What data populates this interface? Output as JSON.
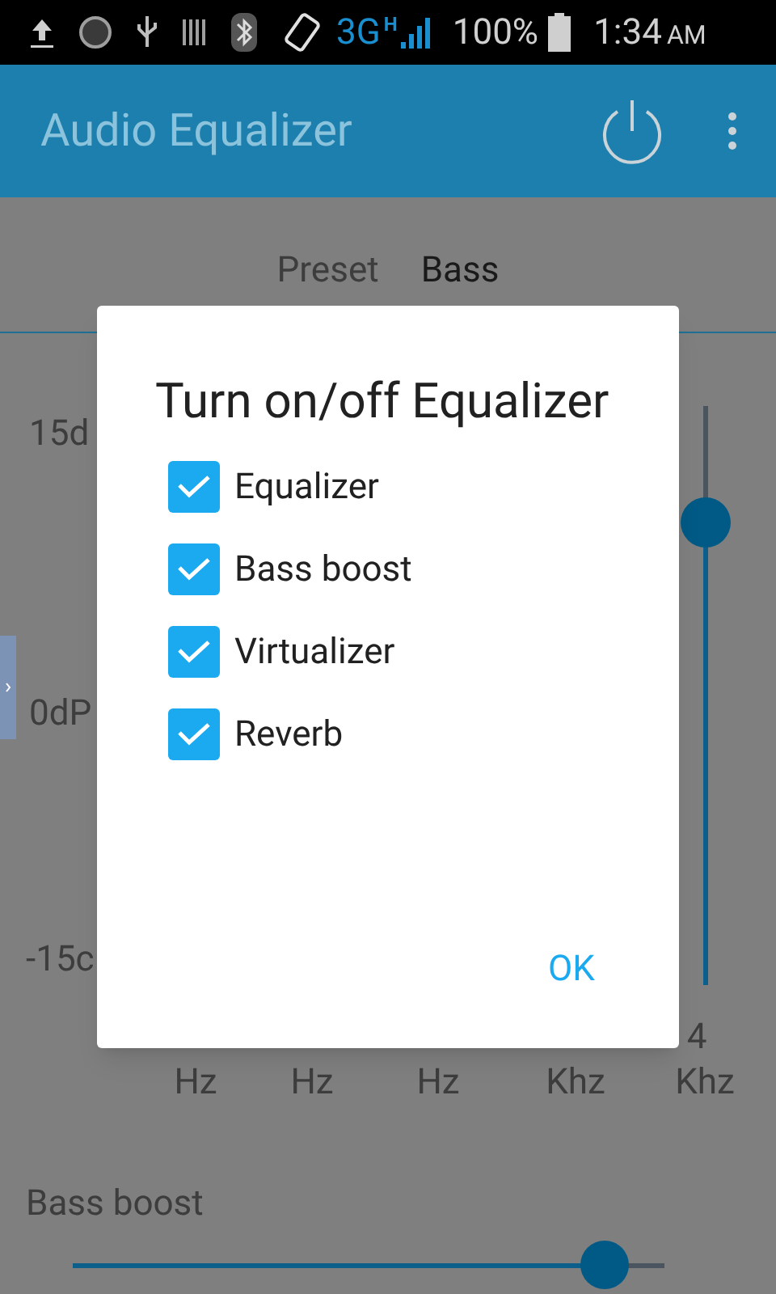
{
  "status_bar": {
    "network": "3G",
    "network_sub": "H",
    "battery": "100%",
    "time": "1:34",
    "time_suffix": "AM"
  },
  "app_bar": {
    "title": "Audio Equalizer"
  },
  "preset": {
    "label": "Preset",
    "value": "Bass"
  },
  "equalizer": {
    "db_labels": [
      "15d",
      "0dP",
      "-15c"
    ],
    "bands": [
      {
        "unit": "Hz"
      },
      {
        "unit": "Hz"
      },
      {
        "unit": "Hz"
      },
      {
        "unit": "Khz"
      },
      {
        "value": "4",
        "unit": "Khz",
        "level": 0.8
      }
    ]
  },
  "bass_boost": {
    "label": "Bass boost",
    "level": 0.9
  },
  "dialog": {
    "title": "Turn on/off Equalizer",
    "options": [
      {
        "label": "Equalizer",
        "checked": true
      },
      {
        "label": "Bass boost",
        "checked": true
      },
      {
        "label": "Virtualizer",
        "checked": true
      },
      {
        "label": "Reverb",
        "checked": true
      }
    ],
    "button": "OK"
  }
}
